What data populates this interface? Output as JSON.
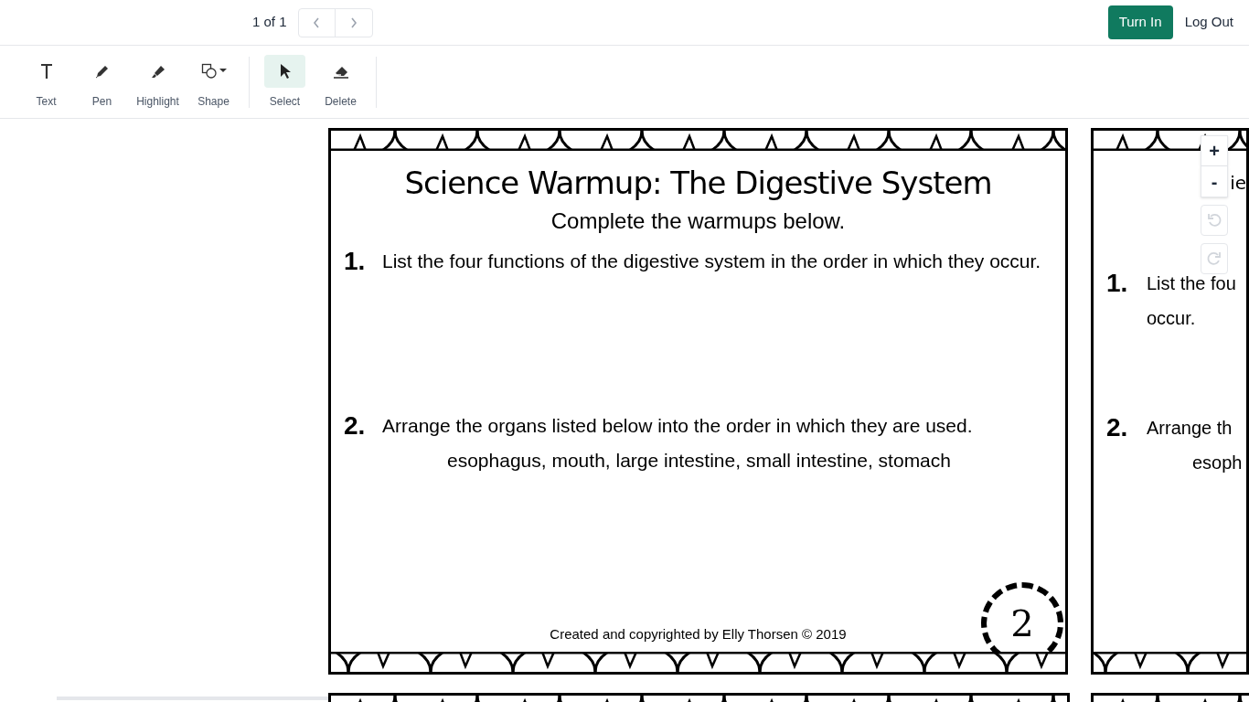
{
  "pager": {
    "label": "1 of 1"
  },
  "header_buttons": [
    {
      "label": "Turn In",
      "kind": "primary"
    },
    {
      "label": "Log Out",
      "kind": "plain"
    }
  ],
  "tools": [
    {
      "label": "Text",
      "kind": "text",
      "selected": false,
      "group_end": false
    },
    {
      "label": "Pen",
      "kind": "pen",
      "selected": false,
      "group_end": false
    },
    {
      "label": "Highlight",
      "kind": "highlight",
      "selected": false,
      "group_end": false
    },
    {
      "label": "Shape",
      "kind": "shape",
      "selected": false,
      "group_end": true
    },
    {
      "label": "Select",
      "kind": "select",
      "selected": true,
      "group_end": false
    },
    {
      "label": "Delete",
      "kind": "delete",
      "selected": false,
      "group_end": true
    }
  ],
  "zoom_controls": [
    {
      "label": "+",
      "kind": "text",
      "disabled": false
    },
    {
      "label": "-",
      "kind": "text",
      "disabled": false
    },
    {
      "kind": "undo",
      "disabled": true
    },
    {
      "kind": "redo",
      "disabled": true
    }
  ],
  "worksheet": {
    "title": "Science Warmup: The Digestive System",
    "subtitle": "Complete the warmups below.",
    "questions": [
      {
        "number": "1.",
        "text": "List the four functions of the digestive system in the order in which they occur."
      },
      {
        "number": "2.",
        "text": "Arrange the organs listed below into the order in which they are used.",
        "list": "esophagus, mouth, large intestine, small intestine, stomach"
      }
    ],
    "footer": "Created and copyrighted by Elly Thorsen © 2019",
    "badge": "2"
  },
  "next_worksheet": {
    "title": "ie",
    "questions": [
      {
        "number": "1.",
        "lines": [
          "List the fou",
          "occur."
        ]
      },
      {
        "number": "2.",
        "lines": [
          "Arrange th",
          "esoph"
        ]
      }
    ]
  }
}
